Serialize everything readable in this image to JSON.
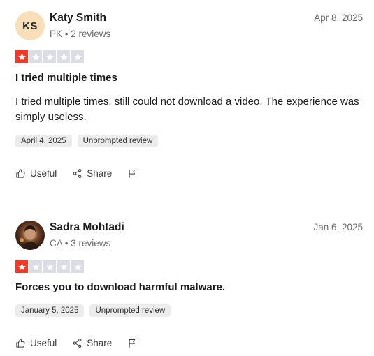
{
  "reviews": [
    {
      "avatar": {
        "initials": "KS",
        "type": "initials",
        "color": "#f8dfb9"
      },
      "name": "Katy Smith",
      "meta": "PK • 2 reviews",
      "date": "Apr 8, 2025",
      "rating": 1,
      "max_rating": 5,
      "title": "I tried multiple times",
      "body": "I tried multiple times, still could not download a video. The experience was simply useless.",
      "tags": [
        "April 4, 2025",
        "Unprompted review"
      ],
      "actions": {
        "useful": "Useful",
        "share": "Share"
      }
    },
    {
      "avatar": {
        "type": "photo"
      },
      "name": "Sadra Mohtadi",
      "meta": "CA • 3 reviews",
      "date": "Jan 6, 2025",
      "rating": 1,
      "max_rating": 5,
      "title": "Forces you to download harmful malware.",
      "tags": [
        "January 5, 2025",
        "Unprompted review"
      ],
      "actions": {
        "useful": "Useful",
        "share": "Share"
      }
    }
  ],
  "colors": {
    "star_on": "#ff3722",
    "star_off": "#dcdce6",
    "tag_bg": "#ececec",
    "muted_text": "#6b6b6b"
  },
  "icons": [
    "thumbs-up-icon",
    "share-icon",
    "flag-icon",
    "star-icon"
  ]
}
